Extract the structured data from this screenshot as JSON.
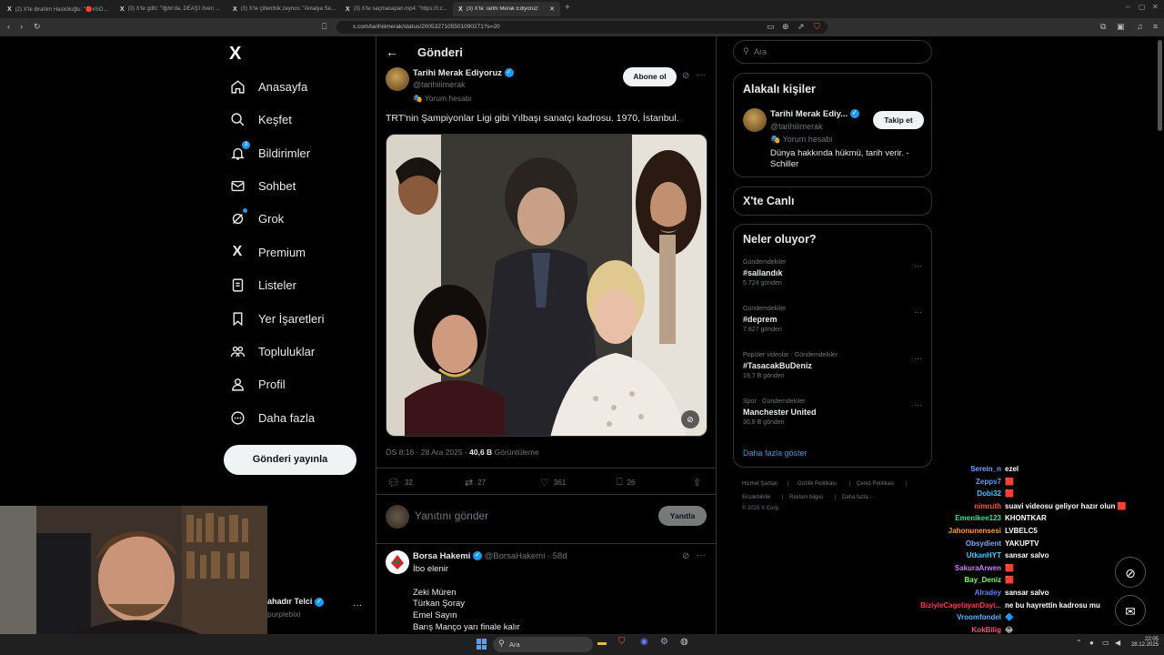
{
  "browser": {
    "tabs": [
      {
        "label": "(2) X'te ibrahim Hasköloğlu: \"🔴#SO...",
        "active": false
      },
      {
        "label": "(3) X'te gdfc: \"Iğdır'da, DEAŞ'i öven ...",
        "active": false
      },
      {
        "label": "(3) X'te çitlembik zeynos: \"Antalya Se...",
        "active": false
      },
      {
        "label": "(3) X'te saçmasapan.mp4: \"https://t.c...",
        "active": false
      },
      {
        "label": "(3) X'te Tarihi Merak Ediyoruz: \"T...",
        "active": true
      }
    ],
    "url": "x.com/tarihiiimerak/status/2005327105501090271?s=20"
  },
  "nav": {
    "logo": "X",
    "items": [
      {
        "label": "Anasayfa",
        "icon": "home-icon"
      },
      {
        "label": "Keşfet",
        "icon": "search-icon"
      },
      {
        "label": "Bildirimler",
        "icon": "bell-icon",
        "badge": "3"
      },
      {
        "label": "Sohbet",
        "icon": "mail-icon"
      },
      {
        "label": "Grok",
        "icon": "grok-icon"
      },
      {
        "label": "Premium",
        "icon": "x-icon"
      },
      {
        "label": "Listeler",
        "icon": "list-icon"
      },
      {
        "label": "Yer İşaretleri",
        "icon": "bookmark-icon"
      },
      {
        "label": "Topluluklar",
        "icon": "communities-icon"
      },
      {
        "label": "Profil",
        "icon": "profile-icon"
      },
      {
        "label": "Daha fazla",
        "icon": "more-icon"
      }
    ],
    "post_button": "Gönderi yayınla",
    "account_name": "ahadır Telci",
    "account_handle": "purplebixi"
  },
  "main": {
    "header_title": "Gönderi",
    "author": {
      "name": "Tarihi Merak Ediyoruz",
      "handle": "@tarihiiimerak",
      "label": "Yorum hesabı"
    },
    "subscribe_label": "Abone ol",
    "text": "TRT'nin Şampiyonlar Ligi gibi Yılbaşı sanatçı kadrosu. 1970, İstanbul.",
    "meta_time": "ÖS 8:16 · 28 Ara 2025 · ",
    "meta_views": "40,6 B",
    "meta_views_label": " Görüntüleme",
    "actions": {
      "replies": "32",
      "reposts": "27",
      "likes": "361",
      "bookmarks": "26"
    },
    "reply_placeholder": "Yanıtını gönder",
    "reply_button": "Yanıtla",
    "reply": {
      "name": "Borsa Hakemi",
      "handle": "@BorsaHakemi · 58d",
      "lines": [
        "İbo elenir",
        "",
        "Zeki Müren",
        "Türkan Şoray",
        "Emel Sayın",
        "Barış Manço yarı finale kalır"
      ]
    }
  },
  "right": {
    "search_placeholder": "Ara",
    "related_title": "Alakalı kişiler",
    "related": {
      "name": "Tarihi Merak Ediy...",
      "handle": "@tarihiiimerak",
      "label": "Yorum hesabı",
      "bio": "Dünya hakkında hükmü, tarih verir. - Schiller",
      "follow": "Takip et"
    },
    "live_title": "X'te Canlı",
    "happening_title": "Neler oluyor?",
    "trends": [
      {
        "category": "Gündemdekiler",
        "name": "#sallandık",
        "count": "5.724 gönderi"
      },
      {
        "category": "Gündemdekiler",
        "name": "#deprem",
        "count": "7.827 gönderi"
      },
      {
        "category": "Popüler videolar · Gündemdekiler",
        "name": "#TasacakBuDeniz",
        "count": "19,7 B gönderi"
      },
      {
        "category": "Spor · Gündemdekiler",
        "name": "Manchester United",
        "count": "30,8 B gönderi"
      }
    ],
    "show_more": "Daha fazla göster",
    "footer": [
      "Hizmet Şartları",
      "Gizlilik Politikası",
      "Çerez Politikası",
      "Erişilebilirlik",
      "Reklam bilgisi",
      "Daha fazla ···",
      "© 2025 X Corp."
    ]
  },
  "chat": [
    {
      "user": "Serein_n",
      "msg": "ezel",
      "color": "#6fa8ff"
    },
    {
      "user": "Zepps7",
      "msg": "🟥",
      "color": "#5b9bff"
    },
    {
      "user": "Dobi32",
      "msg": "🟥",
      "color": "#44c6ff"
    },
    {
      "user": "nimruth",
      "msg": "suavi videosu geliyor hazır olun 🟥",
      "color": "#ff4d4d"
    },
    {
      "user": "Emenikee123",
      "msg": "KHONTKAR",
      "color": "#2fe0a0"
    },
    {
      "user": "Jahonunensesi",
      "msg": "LVBELC5",
      "color": "#ff9f30"
    },
    {
      "user": "Obsydient",
      "msg": "YAKUPTV",
      "color": "#7aa8ff"
    },
    {
      "user": "UtkanHYT",
      "msg": "sansar salvo",
      "color": "#29d3ff"
    },
    {
      "user": "SakuraArwen",
      "msg": "🟥",
      "color": "#c77dff"
    },
    {
      "user": "Bay_Deniz",
      "msg": "🟥",
      "color": "#7cff5a"
    },
    {
      "user": "Alradey",
      "msg": "sansar salvo",
      "color": "#5b7fff"
    },
    {
      "user": "BiziyleCagelayanDayi...",
      "msg": "ne bu hayrettin kadrosu mu",
      "color": "#ff3355"
    },
    {
      "user": "Vroomfondel",
      "msg": "🔷",
      "color": "#5ab4ff"
    },
    {
      "user": "KokBilig",
      "msg": "😂",
      "color": "#ff4d7a"
    },
    {
      "user": "EmreKarslan",
      "msg": "",
      "color": "#c05cff"
    }
  ],
  "taskbar": {
    "search_label": "Ara",
    "time": "22:05",
    "date": "28.12.2025"
  }
}
